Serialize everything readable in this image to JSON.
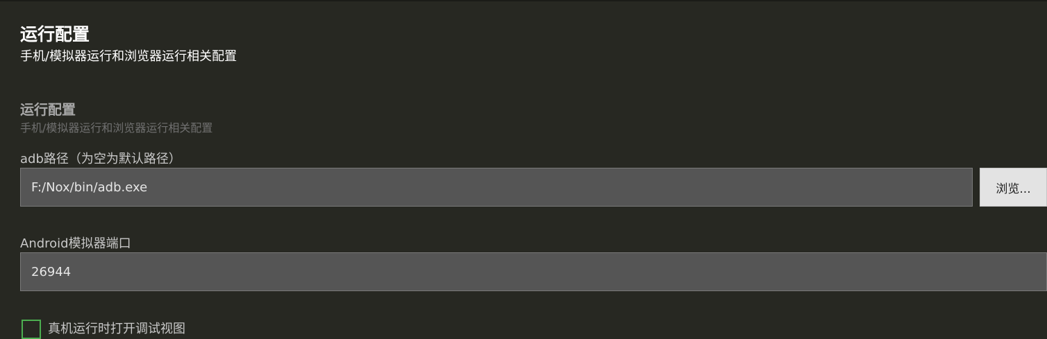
{
  "header": {
    "title": "运行配置",
    "subtitle": "手机/模拟器运行和浏览器运行相关配置"
  },
  "section": {
    "title": "运行配置",
    "subtitle": "手机/模拟器运行和浏览器运行相关配置"
  },
  "adb": {
    "label": "adb路径（为空为默认路径）",
    "value": "F:/Nox/bin/adb.exe",
    "browse_label": "浏览..."
  },
  "port": {
    "label": "Android模拟器端口",
    "value": "26944"
  },
  "debug_view": {
    "label": "真机运行时打开调试视图",
    "checked": false
  },
  "colors": {
    "background": "#272822",
    "input_background": "#555555",
    "checkbox_border": "#4caf50"
  }
}
